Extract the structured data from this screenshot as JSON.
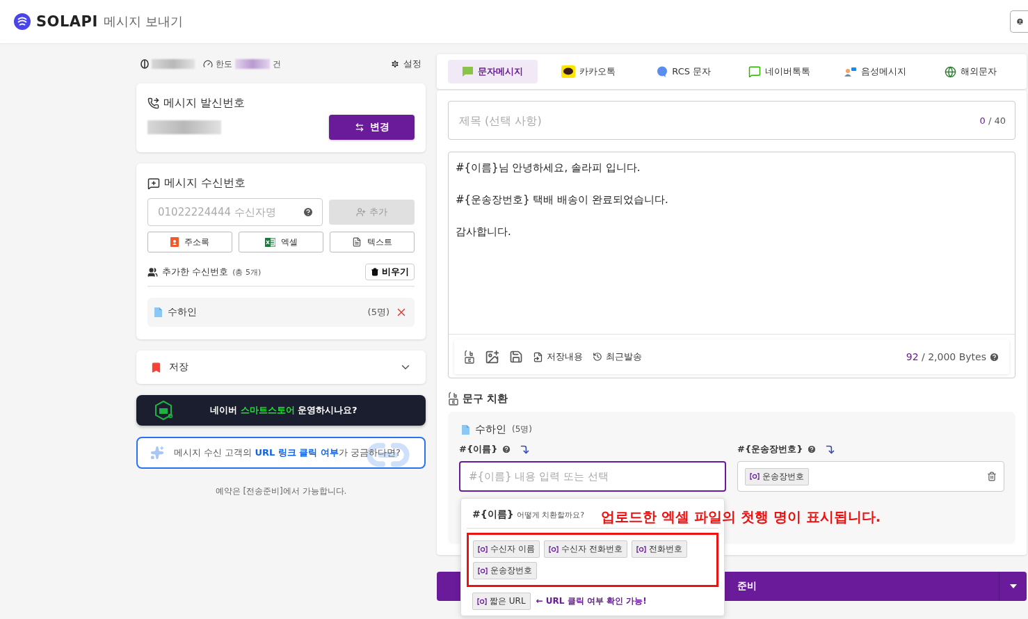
{
  "header": {
    "brand": "SOLAPI",
    "title": "메시지 보내기"
  },
  "account_bar": {
    "limit_label": "한도",
    "limit_unit": "건",
    "settings": "설정"
  },
  "sender": {
    "title": "메시지 발신번호",
    "change_button": "변경"
  },
  "recipients": {
    "title": "메시지 수신번호",
    "input_placeholder": "01022224444 수신자명",
    "add_button": "추가",
    "add_disabled": true,
    "sources": [
      {
        "kind": "contacts",
        "label": "주소록"
      },
      {
        "kind": "excel",
        "label": "엑셀"
      },
      {
        "kind": "text",
        "label": "텍스트"
      }
    ],
    "added_label": "추가한 수신번호",
    "added_total": "(총 5개)",
    "clear_button": "비우기",
    "groups": [
      {
        "name": "수하인",
        "count": "(5명)"
      }
    ]
  },
  "saved": {
    "title": "저장",
    "expanded": false
  },
  "banners": [
    {
      "kind": "dark",
      "text": "네이버 **스마트스토어** 운영하시나요?"
    },
    {
      "kind": "outline",
      "text": "메시지 수신 고객의 **URL 링크 클릭 여부**가 궁금하다면?"
    }
  ],
  "note": "예약은 [전송준비]에서 가능합니다.",
  "tabs": [
    {
      "kind": "sms",
      "label": "문자메시지",
      "selected": true
    },
    {
      "kind": "kakao",
      "label": "카카오톡",
      "selected": false
    },
    {
      "kind": "rcs",
      "label": "RCS 문자",
      "selected": false
    },
    {
      "kind": "naver",
      "label": "네이버톡톡",
      "selected": false
    },
    {
      "kind": "voice",
      "label": "음성메시지",
      "selected": false
    },
    {
      "kind": "global",
      "label": "해외문자",
      "selected": false
    }
  ],
  "subject": {
    "placeholder": "제목 (선택 사항)",
    "count": "0",
    "limit": "/ 40"
  },
  "body": {
    "value": "#{이름}님 안녕하세요, 솔라피 입니다.\n\n#{운송장번호} 택배 배송이 완료되었습니다.\n\n감사합니다."
  },
  "toolbar": {
    "items": [
      {
        "kind": "replace"
      },
      {
        "kind": "image"
      },
      {
        "kind": "save"
      },
      {
        "kind": "saved",
        "label": "저장내용"
      },
      {
        "kind": "recent",
        "label": "최근발송"
      }
    ],
    "bytes": "92",
    "bytes_limit": "/ 2,000 Bytes"
  },
  "replace": {
    "title": "문구 치환",
    "group": {
      "name": "수하인",
      "count": "(5명)"
    },
    "variables": [
      {
        "kind": "input",
        "name": "#{이름}",
        "placeholder": "#{이름} 내용 입력 또는 선택",
        "focused": true
      },
      {
        "kind": "chip",
        "name": "#{운송장번호}",
        "chip": "운송장번호",
        "focused": false
      }
    ]
  },
  "popup": {
    "title": "#{이름}",
    "question": "어떻게 치환할까요?",
    "options": [
      "수신자 이름",
      "수신자 전화번호",
      "전화번호",
      "운송장번호"
    ],
    "short_url": "짧은 URL",
    "short_url_hint": "← URL 클릭 여부 확인 가능!"
  },
  "annotation": {
    "text": "업로드한 엑셀 파일의 첫행 명이 표시됩니다."
  },
  "send_button": {
    "label": "준비"
  }
}
